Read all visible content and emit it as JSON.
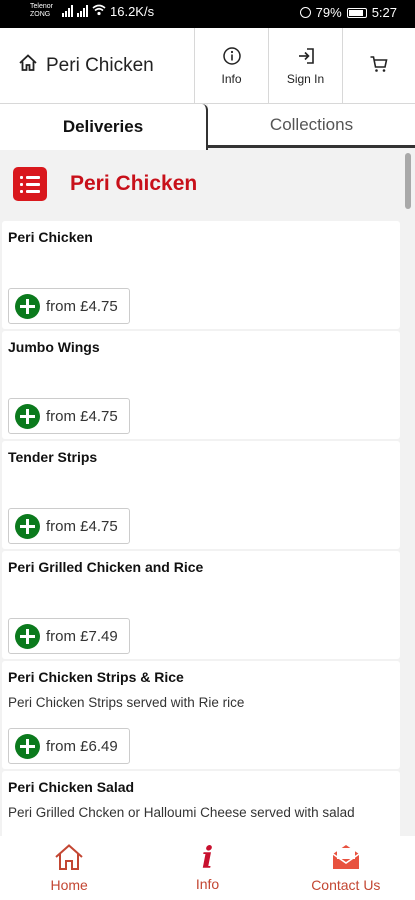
{
  "status_bar": {
    "carrier": "Telenor ZONG",
    "network_speed": "16.2K/s",
    "battery": "79%",
    "time": "5:27"
  },
  "header": {
    "title": "Peri Chicken",
    "info_label": "Info",
    "sign_in_label": "Sign In"
  },
  "tabs": {
    "deliveries": "Deliveries",
    "collections": "Collections"
  },
  "category": {
    "title": "Peri Chicken"
  },
  "items": [
    {
      "name": "Peri Chicken",
      "description": "",
      "price": "from £4.75"
    },
    {
      "name": "Jumbo Wings",
      "description": "",
      "price": "from £4.75"
    },
    {
      "name": "Tender Strips",
      "description": "",
      "price": "from £4.75"
    },
    {
      "name": "Peri Grilled Chicken and Rice",
      "description": "",
      "price": "from £7.49"
    },
    {
      "name": "Peri Chicken Strips & Rice",
      "description": "Peri Chicken Strips served with Rie rice",
      "price": "from £6.49"
    },
    {
      "name": "Peri Chicken Salad",
      "description": "Peri Grilled Chcken or Halloumi Cheese served with salad",
      "price": ""
    }
  ],
  "scroll": {
    "position_fraction": 0.0
  },
  "bottom_nav": {
    "home": "Home",
    "info": "Info",
    "contact": "Contact Us"
  },
  "colors": {
    "brand_red": "#c8101a",
    "add_green": "#0b7a1d",
    "nav_text": "#c34632"
  },
  "icons": {
    "home": "home-icon",
    "info": "info-circle-icon",
    "sign_in": "sign-in-icon",
    "cart": "cart-icon",
    "category": "list-icon",
    "add": "plus-circle-icon",
    "contact": "mail-icon"
  }
}
